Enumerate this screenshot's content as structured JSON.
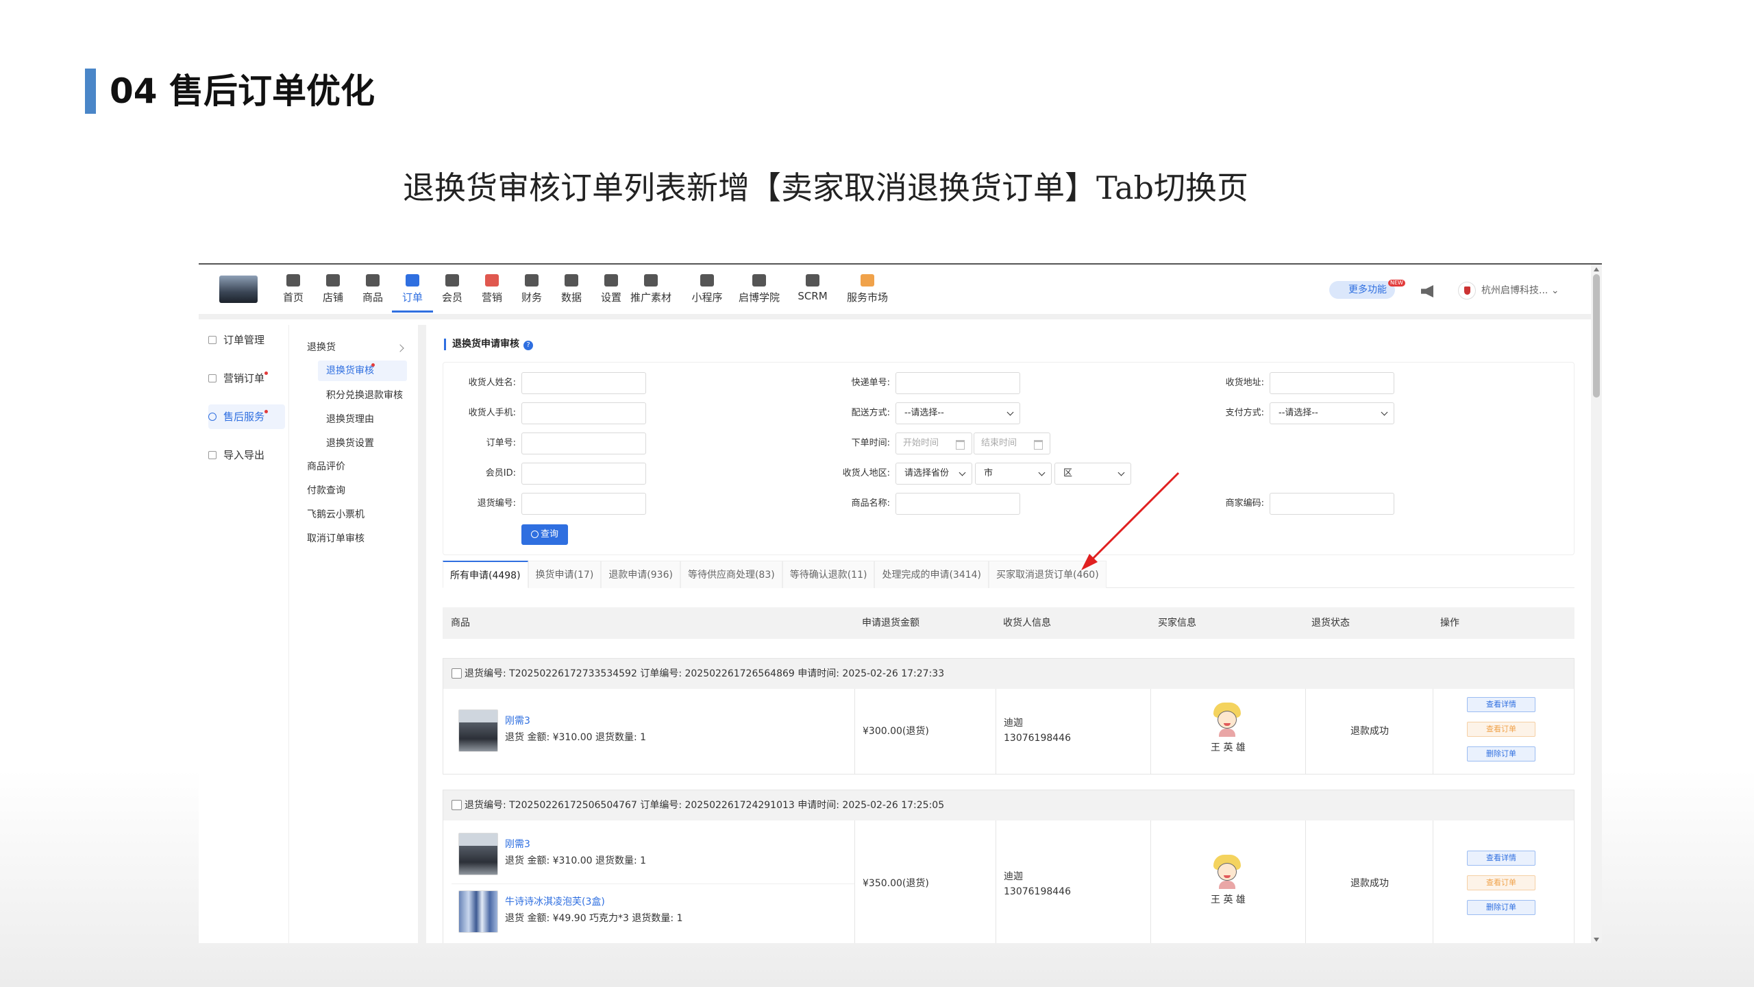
{
  "slide": {
    "title": "04 售后订单优化",
    "subtitle": "退换货审核订单列表新增【卖家取消退换货订单】Tab切换页"
  },
  "topnav": {
    "items": [
      {
        "label": "首页",
        "icon": "home-icon",
        "color": "#555555"
      },
      {
        "label": "店铺",
        "icon": "store-icon",
        "color": "#555555"
      },
      {
        "label": "商品",
        "icon": "goods-icon",
        "color": "#555555"
      },
      {
        "label": "订单",
        "icon": "order-icon",
        "color": "#2f6fe0"
      },
      {
        "label": "会员",
        "icon": "member-icon",
        "color": "#555555"
      },
      {
        "label": "营销",
        "icon": "marketing-icon",
        "color": "#e0584f"
      },
      {
        "label": "财务",
        "icon": "finance-icon",
        "color": "#555555"
      },
      {
        "label": "数据",
        "icon": "data-icon",
        "color": "#555555"
      },
      {
        "label": "设置",
        "icon": "settings-icon",
        "color": "#555555"
      },
      {
        "label": "推广素材",
        "icon": "share-icon",
        "color": "#555555"
      },
      {
        "label": "小程序",
        "icon": "miniapp-icon",
        "color": "#555555"
      },
      {
        "label": "启博学院",
        "icon": "academy-icon",
        "color": "#555555"
      },
      {
        "label": "SCRM",
        "icon": "scrm-icon",
        "color": "#555555"
      },
      {
        "label": "服务市场",
        "icon": "market-icon",
        "color": "#f0a24a"
      }
    ],
    "more_label": "更多功能",
    "new_badge": "NEW",
    "company": "杭州启博科技...",
    "accent": "#2f6fe0"
  },
  "sidebar1": {
    "items": [
      {
        "label": "订单管理",
        "icon": "list-icon"
      },
      {
        "label": "营销订单",
        "icon": "list-icon"
      },
      {
        "label": "售后服务",
        "icon": "service-icon"
      },
      {
        "label": "导入导出",
        "icon": "import-icon"
      }
    ]
  },
  "sidebar2": {
    "group": "退换货",
    "sub_items": [
      "退换货审核",
      "积分兑换退款审核",
      "退换货理由",
      "退换货设置"
    ],
    "items": [
      "商品评价",
      "付款查询",
      "飞鹅云小票机",
      "取消订单审核"
    ]
  },
  "page": {
    "heading": "退换货申请审核",
    "help": "?"
  },
  "filters": {
    "receiver_name": "收货人姓名:",
    "express_no": "快递单号:",
    "receiver_addr": "收货地址:",
    "receiver_phone": "收货人手机:",
    "delivery": "配送方式:",
    "delivery_value": "--请选择--",
    "pay": "支付方式:",
    "pay_value": "--请选择--",
    "order_no": "订单号:",
    "order_time": "下单时间:",
    "start_time": "开始时间",
    "end_time": "结束时间",
    "member_id": "会员ID:",
    "region": "收货人地区:",
    "province": "请选择省份",
    "city": "市",
    "district": "区",
    "return_no": "退货编号:",
    "goods_name": "商品名称:",
    "merchant_code": "商家编码:",
    "query": "查询"
  },
  "tabs": [
    "所有申请(4498)",
    "换货申请(17)",
    "退款申请(936)",
    "等待供应商处理(83)",
    "等待确认退款(11)",
    "处理完成的申请(3414)",
    "买家取消退货订单(460)"
  ],
  "table": {
    "headers": [
      "商品",
      "申请退货金额",
      "收货人信息",
      "买家信息",
      "退货状态",
      "操作"
    ]
  },
  "orders": [
    {
      "header": "退货编号: T20250226172733534592 订单编号: 202502261726564869    申请时间: 2025-02-26 17:27:33",
      "products": [
        {
          "name": "刚需3",
          "meta": "退货 金额: ¥310.00    退货数量: 1",
          "thumb": "car-photo"
        }
      ],
      "amount": "¥300.00(退货)",
      "receiver": "迪迦",
      "phone": "13076198446",
      "buyer": "王 英 雄",
      "status": "退款成功",
      "actions": [
        "查看详情",
        "查看订单",
        "删除订单"
      ]
    },
    {
      "header": "退货编号: T20250226172506504767 订单编号: 202502261724291013    申请时间: 2025-02-26 17:25:05",
      "products": [
        {
          "name": "刚需3",
          "meta": "退货 金额: ¥310.00    退货数量: 1",
          "thumb": "car-photo"
        },
        {
          "name": "牛诗诗冰淇凌泡芙(3盒)",
          "meta": "退货 金额: ¥49.90    巧克力*3    退货数量: 1",
          "thumb": "ice-cream-photo"
        }
      ],
      "amount": "¥350.00(退货)",
      "receiver": "迪迦",
      "phone": "13076198446",
      "buyer": "王 英 雄",
      "status": "退款成功",
      "actions": [
        "查看详情",
        "查看订单",
        "删除订单"
      ]
    }
  ]
}
